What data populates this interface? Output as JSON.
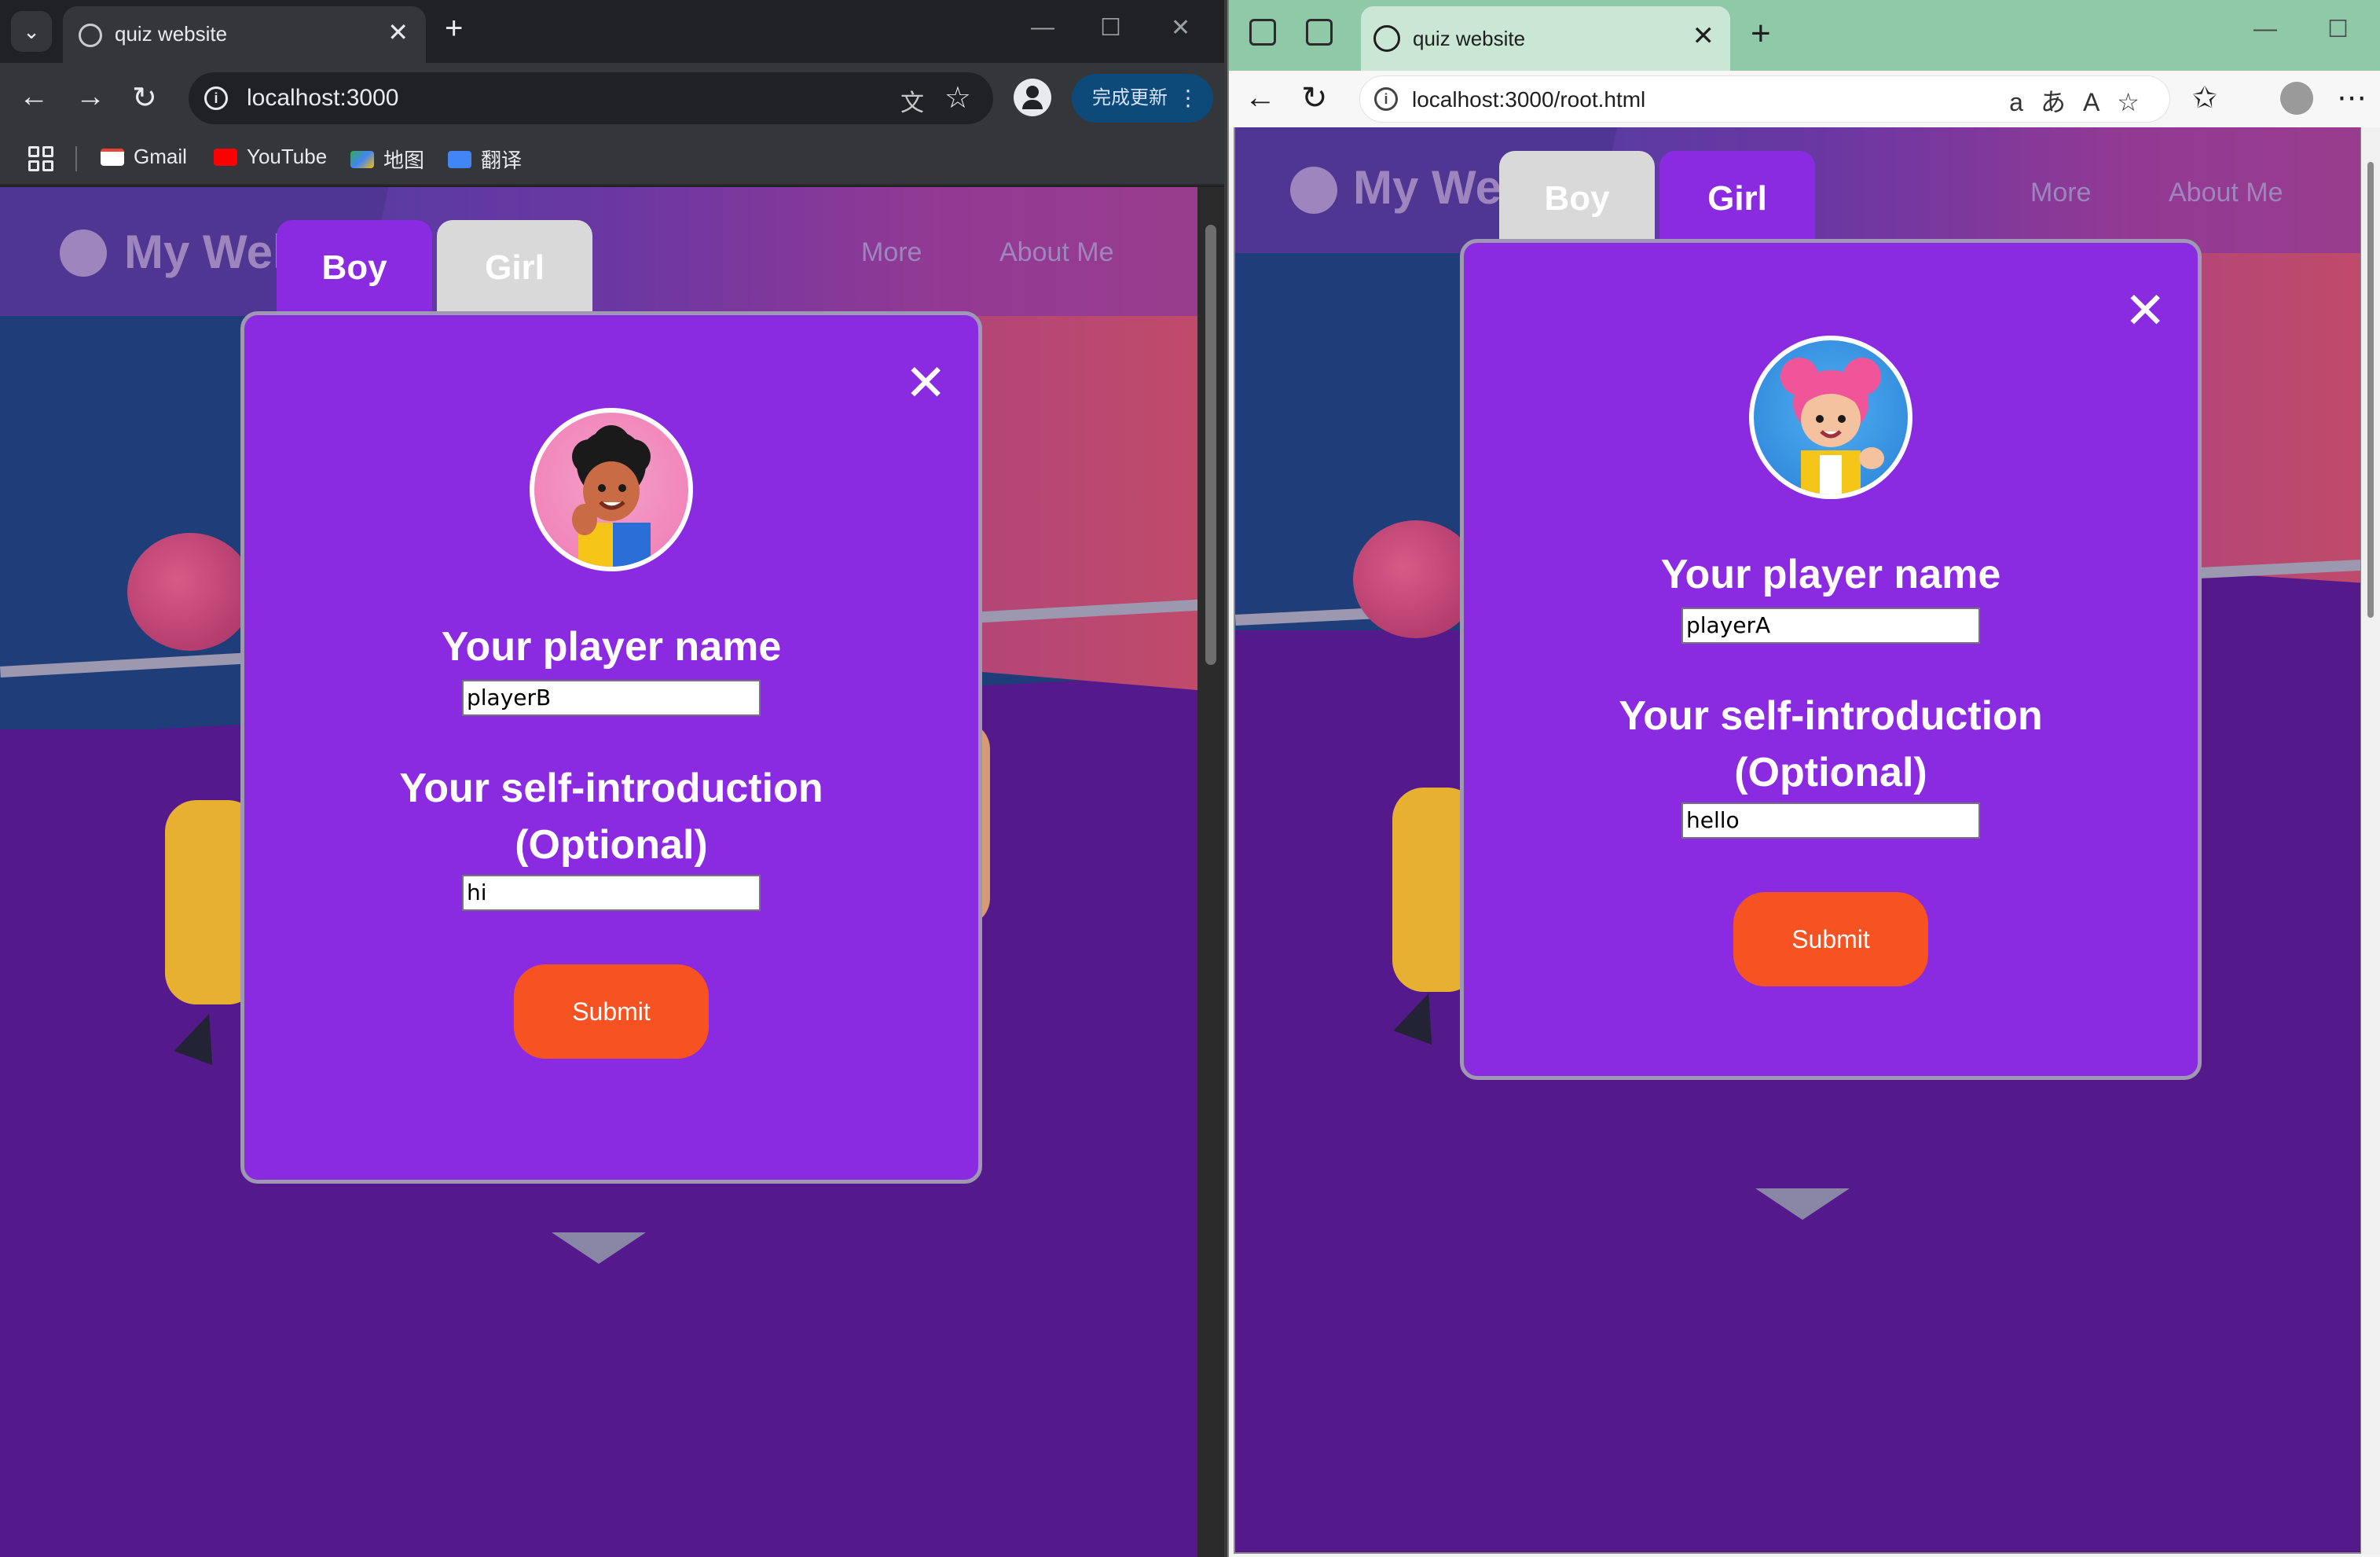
{
  "left_window": {
    "browser": "Chrome",
    "tab_title": "quiz website",
    "url": "localhost:3000",
    "update_button": "完成更新",
    "bookmarks": [
      "Gmail",
      "YouTube",
      "地图",
      "翻译"
    ],
    "page": {
      "logo_text": "My Wel",
      "nav": [
        "More",
        "About Me"
      ],
      "tabs": {
        "boy": "Boy",
        "girl": "Girl",
        "active": "Boy"
      },
      "modal": {
        "name_label": "Your player name",
        "name_value": "playerB",
        "intro_label_line1": "Your self-introduction",
        "intro_label_line2": "(Optional)",
        "intro_value": "hi",
        "submit": "Submit",
        "close": "✕"
      }
    }
  },
  "right_window": {
    "browser": "Edge",
    "tab_title": "quiz website",
    "url": "localhost:3000/root.html",
    "page": {
      "logo_text": "My We",
      "nav": [
        "More",
        "About Me"
      ],
      "tabs": {
        "boy": "Boy",
        "girl": "Girl",
        "active": "Girl"
      },
      "modal": {
        "name_label": "Your player name",
        "name_value": "playerA",
        "intro_label_line1": "Your self-introduction",
        "intro_label_line2": "(Optional)",
        "intro_value": "hello",
        "submit": "Submit",
        "close": "✕"
      }
    }
  },
  "colors": {
    "modal_purple": "#8a2be2",
    "submit_orange": "#f75222",
    "page_purple": "#541a8c",
    "edge_titlebar": "#8fc9a7"
  }
}
